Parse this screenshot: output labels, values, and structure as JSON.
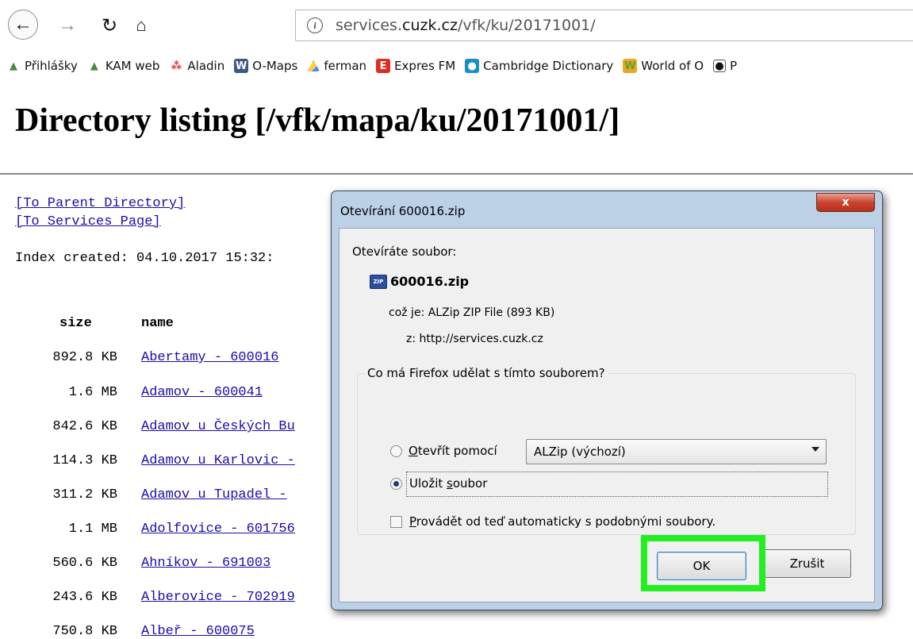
{
  "browser": {
    "url_prefix": "services.",
    "url_domain": "cuzk.cz",
    "url_path": "/vfk/ku/20171001/",
    "bookmarks": [
      {
        "label": "Přihlášky",
        "icon": "orienteering-icon"
      },
      {
        "label": "KAM web",
        "icon": "orienteering-icon"
      },
      {
        "label": "Aladin",
        "icon": "aladin-icon"
      },
      {
        "label": "O-Maps",
        "icon": "wordpress-icon"
      },
      {
        "label": "ferman",
        "icon": "google-drive-icon"
      },
      {
        "label": "Expres FM",
        "icon": "expres-fm-icon"
      },
      {
        "label": "Cambridge Dictionary",
        "icon": "cambridge-icon"
      },
      {
        "label": "World of O",
        "icon": "world-of-o-icon"
      },
      {
        "label": "P",
        "icon": "globe-icon"
      }
    ]
  },
  "page": {
    "title": "Directory listing [/vfk/mapa/ku/20171001/]",
    "parent_link": "[To Parent Directory]",
    "services_link": "[To Services Page]",
    "index_created": "Index created: 04.10.2017 15:32:",
    "table": {
      "headers": {
        "size": "size",
        "name": "name"
      },
      "rows": [
        {
          "size": "892.8 KB",
          "name": "Abertamy - 600016"
        },
        {
          "size": "1.6 MB",
          "name": "Adamov - 600041"
        },
        {
          "size": "842.6 KB",
          "name": "Adamov u Českých Bu"
        },
        {
          "size": "114.3 KB",
          "name": "Adamov u Karlovic -"
        },
        {
          "size": "311.2 KB",
          "name": "Adamov u Tupadel - "
        },
        {
          "size": "1.1 MB",
          "name": "Adolfovice - 601756"
        },
        {
          "size": "560.6 KB",
          "name": "Ahníkov - 691003"
        },
        {
          "size": "243.6 KB",
          "name": "Alberovice - 702919"
        },
        {
          "size": "750.8 KB",
          "name": "Albeř - 600075"
        }
      ]
    }
  },
  "dialog": {
    "title": "Otevírání 600016.zip",
    "close_label": "x",
    "opening_label": "Otevíráte soubor:",
    "zip_icon_text": "ZIP",
    "file_name": "600016.zip",
    "file_type": "což je:  ALZip ZIP File (893 KB)",
    "file_from": "z:  http://services.cuzk.cz",
    "group_legend": "Co má Firefox udělat s tímto souborem?",
    "open_with_first": "O",
    "open_with_rest": "tevřít pomocí",
    "open_with_value": "ALZip (výchozí)",
    "save_first": "Uložit ",
    "save_u": "s",
    "save_rest": "oubor",
    "auto_first": "P",
    "auto_rest": "rovádět od teď automaticky s podobnými soubory.",
    "ok_label": "OK",
    "cancel_label": "Zrušit"
  },
  "colors": {
    "highlight": "#22ee22",
    "link": "#1a0dab"
  }
}
